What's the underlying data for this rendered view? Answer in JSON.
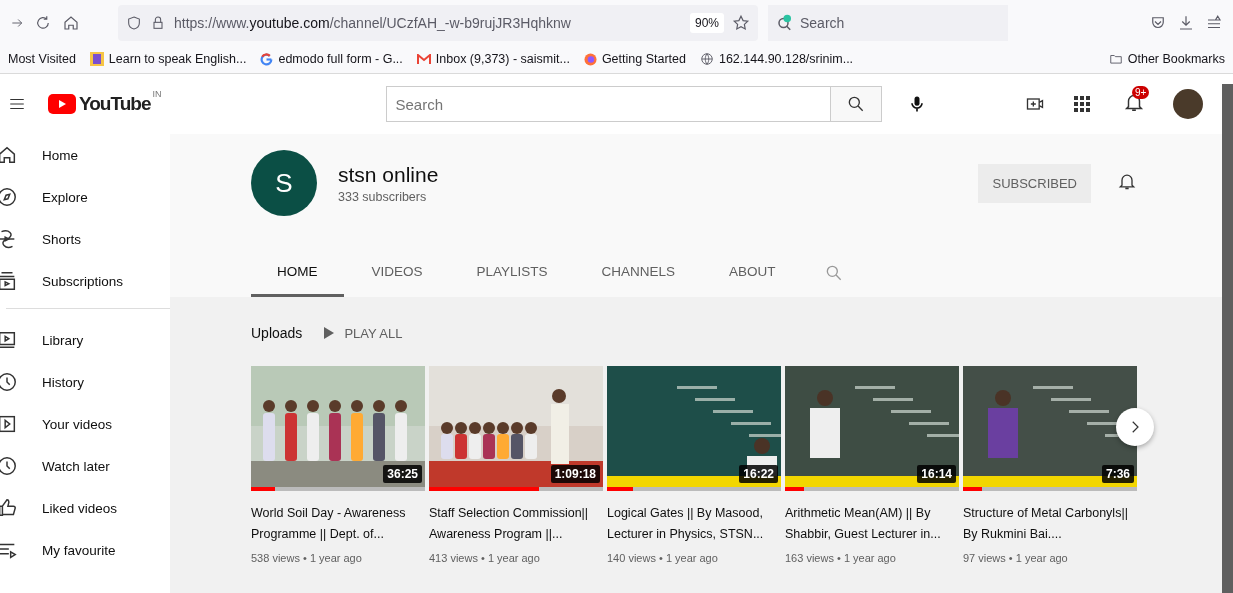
{
  "browser": {
    "url_prefix": "https://www.",
    "url_domain": "youtube.com",
    "url_path": "/channel/UCzfAH_-w-b9rujJR3Hqhknw",
    "zoom": "90%",
    "search_placeholder": "Search",
    "bookmarks": [
      "Most Visited",
      "Learn to speak English...",
      "edmodo full form - G...",
      "Inbox (9,373) - saismit...",
      "Getting Started",
      "162.144.90.128/srinim..."
    ],
    "other_bookmarks": "Other Bookmarks"
  },
  "masthead": {
    "logo": "YouTube",
    "country": "IN",
    "search_placeholder": "Search",
    "notification_count": "9+"
  },
  "sidebar": {
    "sections": [
      [
        {
          "label": "Home",
          "selected": false
        },
        {
          "label": "Explore",
          "selected": false
        },
        {
          "label": "Shorts",
          "selected": false
        },
        {
          "label": "Subscriptions",
          "selected": false
        }
      ],
      [
        {
          "label": "Library",
          "selected": false
        },
        {
          "label": "History",
          "selected": false
        },
        {
          "label": "Your videos",
          "selected": false
        },
        {
          "label": "Watch later",
          "selected": false
        },
        {
          "label": "Liked videos",
          "selected": false
        },
        {
          "label": "My favourite",
          "selected": false
        }
      ]
    ]
  },
  "channel": {
    "avatar_letter": "S",
    "name": "stsn online",
    "subscribers": "333 subscribers",
    "subscribe_button": "SUBSCRIBED",
    "tabs": [
      {
        "label": "HOME",
        "selected": true
      },
      {
        "label": "VIDEOS",
        "selected": false
      },
      {
        "label": "PLAYLISTS",
        "selected": false
      },
      {
        "label": "CHANNELS",
        "selected": false
      },
      {
        "label": "ABOUT",
        "selected": false
      }
    ]
  },
  "uploads": {
    "title": "Uploads",
    "play_all": "PLAY ALL",
    "videos": [
      {
        "title": "World Soil Day - Awareness Programme || Dept. of...",
        "meta": "538 views • 1 year ago",
        "duration": "36:25",
        "level": 0.14
      },
      {
        "title": "Staff Selection Commission|| Awareness Program ||...",
        "meta": "413 views • 1 year ago",
        "duration": "1:09:18",
        "level": 0.63
      },
      {
        "title": "Logical Gates || By Masood, Lecturer in Physics, STSN...",
        "meta": "140 views • 1 year ago",
        "duration": "16:22",
        "level": 0.15
      },
      {
        "title": "Arithmetic Mean(AM) || By Shabbir, Guest Lecturer in...",
        "meta": "163 views • 1 year ago",
        "duration": "16:14",
        "level": 0.11
      },
      {
        "title": "Structure of Metal Carbonyls|| By Rukmini Bai....",
        "meta": "97 views • 1 year ago",
        "duration": "7:36",
        "level": 0.11
      }
    ]
  }
}
